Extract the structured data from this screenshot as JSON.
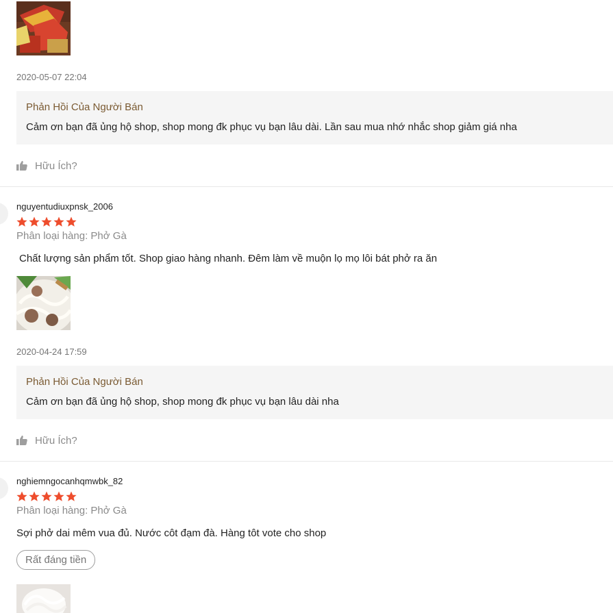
{
  "reviews": [
    {
      "timestamp": "2020-05-07 22:04",
      "reply_title": "Phản Hồi Của Người Bán",
      "reply_text": "Cảm ơn bạn đã ủng hộ shop, shop mong đk phục vụ bạn lâu dài. Lần sau mua nhớ nhắc shop giảm giá nha",
      "helpful": "Hữu Ích?"
    },
    {
      "username": "nguyentudiuxpnsk_2006",
      "rating": 5,
      "variant": "Phân loại hàng: Phở Gà",
      "comment": "Chất lượng sản phẩm tốt. Shop giao hàng nhanh. Đêm làm về muộn lọ mọ lôi bát phở ra ăn",
      "timestamp": "2020-04-24 17:59",
      "reply_title": "Phản Hồi Của Người Bán",
      "reply_text": "Cảm ơn bạn đã ủng hộ shop, shop mong  đk phục vụ bạn lâu dài nha",
      "helpful": "Hữu Ích?"
    },
    {
      "username": "nghiemngocanhqmwbk_82",
      "rating": 5,
      "variant": "Phân loại hàng: Phở Gà",
      "comment": "Sợi phở dai mêm vua đủ. Nước côt đạm đà. Hàng tôt vote cho shop",
      "tag": "Rất đáng tiền"
    }
  ],
  "colors": {
    "star": "#ee4d2d",
    "reply_title": "#7a5a32",
    "reply_bg": "#f5f5f5"
  },
  "icons": {
    "helpful": "thumbs-up-icon",
    "star": "star-icon"
  }
}
